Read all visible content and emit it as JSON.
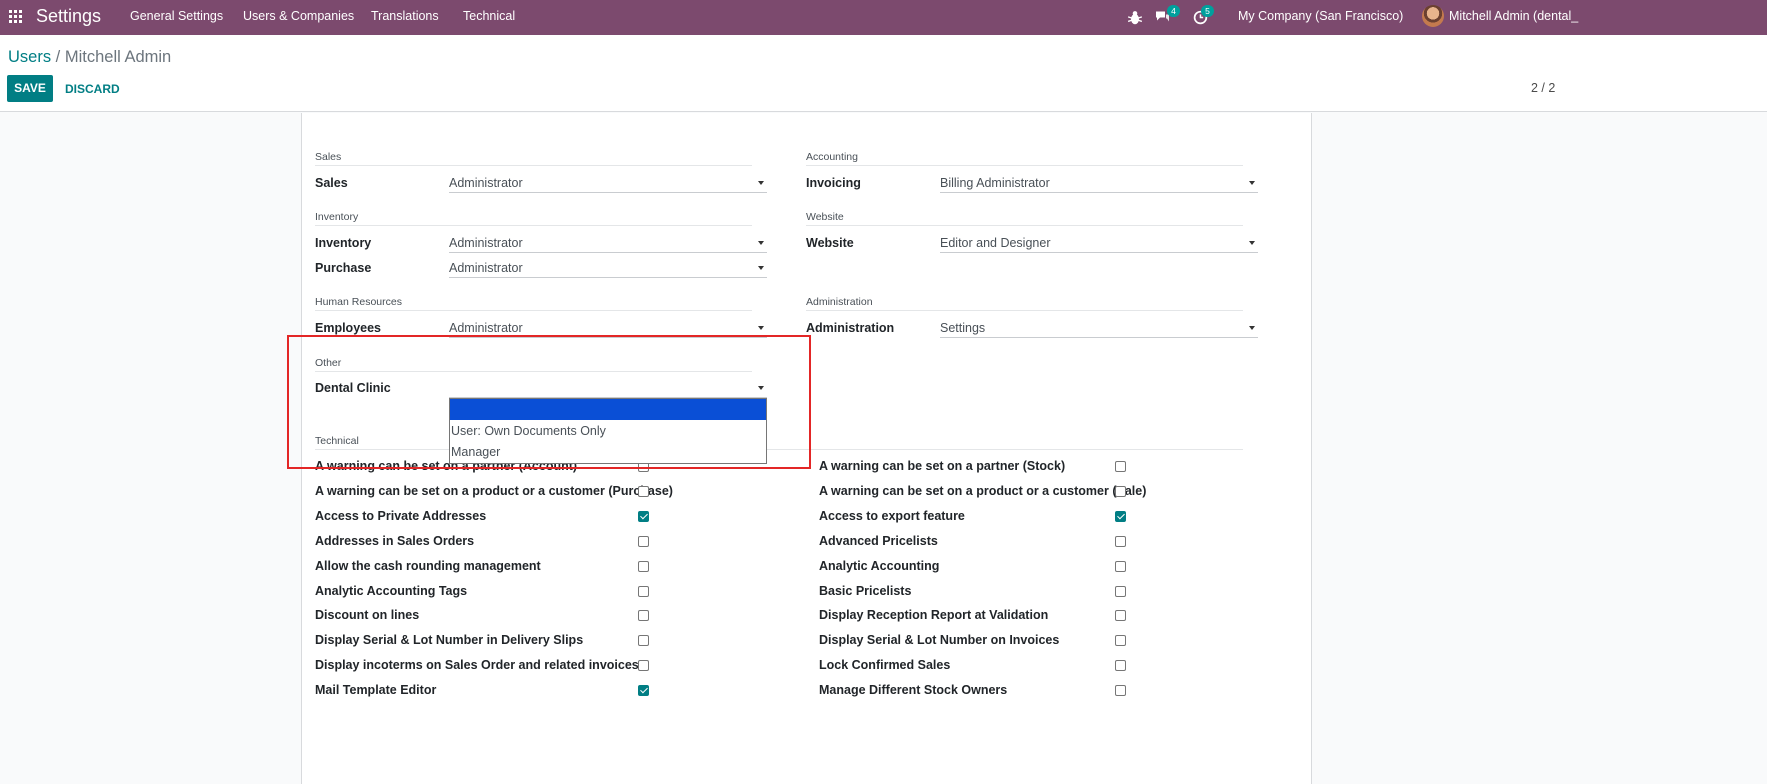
{
  "navbar": {
    "app_title": "Settings",
    "menu": [
      "General Settings",
      "Users & Companies",
      "Translations",
      "Technical"
    ],
    "chat_badge": "4",
    "activity_badge": "5",
    "company": "My Company (San Francisco)",
    "user": "Mitchell Admin (dental_"
  },
  "breadcrumb": {
    "parent": "Users",
    "sep": " / ",
    "current": "Mitchell Admin"
  },
  "buttons": {
    "save": "SAVE",
    "discard": "DISCARD"
  },
  "pager": "2 / 2",
  "left": {
    "sales_section": "Sales",
    "sales_label": "Sales",
    "sales_value": "Administrator",
    "inventory_section": "Inventory",
    "inventory_label": "Inventory",
    "inventory_value": "Administrator",
    "purchase_label": "Purchase",
    "purchase_value": "Administrator",
    "hr_section": "Human Resources",
    "employees_label": "Employees",
    "employees_value": "Administrator",
    "other_section": "Other",
    "dental_label": "Dental Clinic",
    "dental_value": ""
  },
  "right": {
    "accounting_section": "Accounting",
    "invoicing_label": "Invoicing",
    "invoicing_value": "Billing Administrator",
    "website_section": "Website",
    "website_label": "Website",
    "website_value": "Editor and Designer",
    "admin_section": "Administration",
    "admin_label": "Administration",
    "admin_value": "Settings"
  },
  "dropdown": {
    "options": [
      "",
      "User: Own Documents Only",
      "Manager"
    ],
    "selected_index": 0
  },
  "technical": {
    "section": "Technical",
    "left": [
      {
        "label": "A warning can be set on a partner (Account)",
        "checked": false
      },
      {
        "label": "A warning can be set on a product or a customer (Purchase)",
        "checked": false
      },
      {
        "label": "Access to Private Addresses",
        "checked": true
      },
      {
        "label": "Addresses in Sales Orders",
        "checked": false
      },
      {
        "label": "Allow the cash rounding management",
        "checked": false
      },
      {
        "label": "Analytic Accounting Tags",
        "checked": false
      },
      {
        "label": "Discount on lines",
        "checked": false
      },
      {
        "label": "Display Serial & Lot Number in Delivery Slips",
        "checked": false
      },
      {
        "label": "Display incoterms on Sales Order and related invoices",
        "checked": false
      },
      {
        "label": "Mail Template Editor",
        "checked": true
      }
    ],
    "right": [
      {
        "label": "A warning can be set on a partner (Stock)",
        "checked": false
      },
      {
        "label": "A warning can be set on a product or a customer (Sale)",
        "checked": false
      },
      {
        "label": "Access to export feature",
        "checked": true
      },
      {
        "label": "Advanced Pricelists",
        "checked": false
      },
      {
        "label": "Analytic Accounting",
        "checked": false
      },
      {
        "label": "Basic Pricelists",
        "checked": false
      },
      {
        "label": "Display Reception Report at Validation",
        "checked": false
      },
      {
        "label": "Display Serial & Lot Number on Invoices",
        "checked": false
      },
      {
        "label": "Lock Confirmed Sales",
        "checked": false
      },
      {
        "label": "Manage Different Stock Owners",
        "checked": false
      }
    ]
  }
}
